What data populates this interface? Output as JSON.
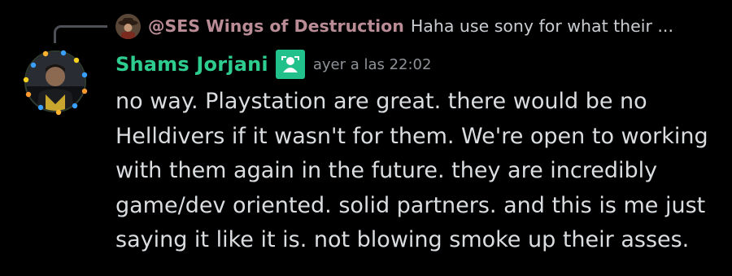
{
  "reply": {
    "author": "@SES Wings of Destruction",
    "text": "Haha use sony for what their ..."
  },
  "message": {
    "username": "Shams Jorjani",
    "timestamp": "ayer a las 22:02",
    "lines": [
      "no way. Playstation are great. there would be no",
      "Helldivers if it wasn't for them. We're open to working",
      "with them again in the future. they are incredibly",
      "game/dev oriented. solid partners. and this is me just",
      "saying it like it is. not blowing smoke up their asses."
    ]
  },
  "colors": {
    "background": "#000000",
    "username": "#2ecc8f",
    "reply_author": "#b98c96",
    "timestamp": "#8e9297",
    "text": "#dbdee1"
  },
  "icons": {
    "role": "user-role-icon",
    "reply_avatar": "cowboy-avatar-icon",
    "avatar": "starfleet-avatar-with-lights-icon"
  }
}
